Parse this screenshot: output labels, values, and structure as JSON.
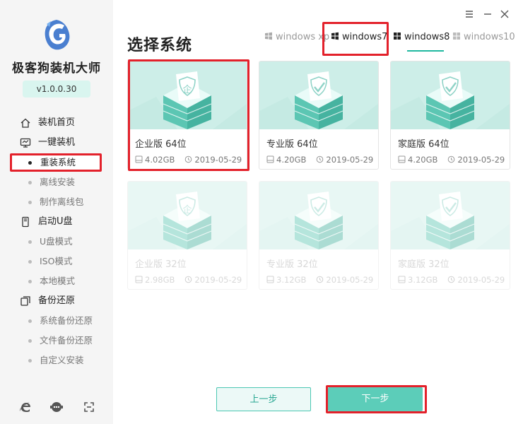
{
  "app": {
    "name": "极客狗装机大师",
    "version": "v1.0.0.30"
  },
  "sidebar": {
    "sections": [
      {
        "label": "装机首页",
        "icon": "home-icon",
        "items": []
      },
      {
        "label": "一键装机",
        "icon": "monitor-icon",
        "items": [
          "重装系统",
          "离线安装",
          "制作离线包"
        ]
      },
      {
        "label": "启动U盘",
        "icon": "usb-icon",
        "items": [
          "U盘模式",
          "ISO模式",
          "本地模式"
        ]
      },
      {
        "label": "备份还原",
        "icon": "backup-icon",
        "items": [
          "系统备份还原",
          "文件备份还原",
          "自定义安装"
        ]
      }
    ],
    "active_item": "重装系统",
    "footer_icons": [
      "browser-icon",
      "chat-icon",
      "fullscreen-icon"
    ]
  },
  "window_controls": [
    "menu-icon",
    "minimize-icon",
    "close-icon"
  ],
  "page": {
    "title": "选择系统"
  },
  "tabs": [
    {
      "label": "windows xp",
      "selected": false
    },
    {
      "label": "windows7",
      "selected": true
    },
    {
      "label": "windows8",
      "selected": false
    },
    {
      "label": "windows10",
      "selected": false
    }
  ],
  "cards": [
    {
      "name": "企业版 64位",
      "size": "4.02GB",
      "date": "2019-05-29",
      "enabled": true,
      "badge": "企"
    },
    {
      "name": "专业版 64位",
      "size": "4.20GB",
      "date": "2019-05-29",
      "enabled": true,
      "badge": "check"
    },
    {
      "name": "家庭版 64位",
      "size": "4.20GB",
      "date": "2019-05-29",
      "enabled": true,
      "badge": "check"
    },
    {
      "name": "企业版 32位",
      "size": "2.98GB",
      "date": "2019-05-29",
      "enabled": false,
      "badge": "企"
    },
    {
      "name": "专业版 32位",
      "size": "3.12GB",
      "date": "2019-05-29",
      "enabled": false,
      "badge": "check"
    },
    {
      "name": "家庭版 32位",
      "size": "3.12GB",
      "date": "2019-05-29",
      "enabled": false,
      "badge": "check"
    }
  ],
  "buttons": {
    "prev": "上一步",
    "next": "下一步"
  },
  "colors": {
    "accent": "#5ccdb9",
    "highlight_red": "#e3212b",
    "sidebar_bg": "#f5f5f5"
  }
}
